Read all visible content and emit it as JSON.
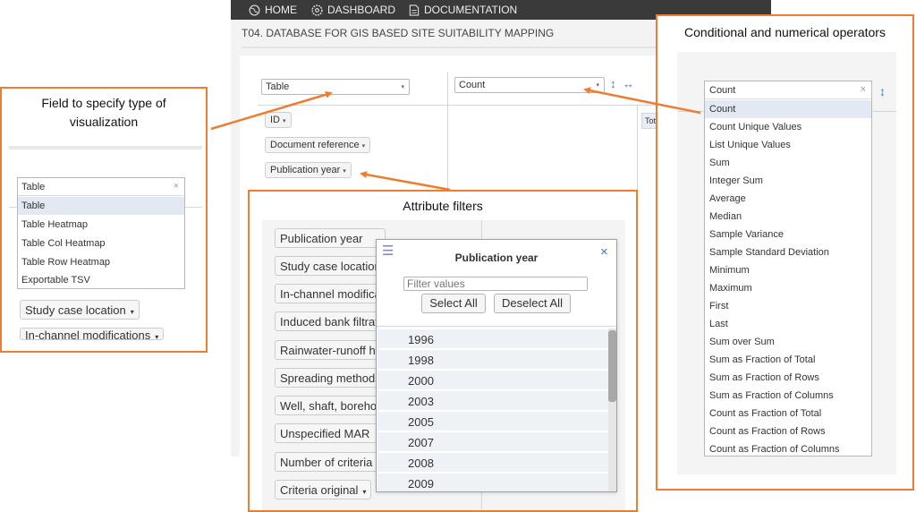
{
  "navbar": {
    "items": [
      {
        "label": "HOME",
        "icon": "globe-icon"
      },
      {
        "label": "DASHBOARD",
        "icon": "gear-icon"
      },
      {
        "label": "DOCUMENTATION",
        "icon": "document-icon"
      }
    ]
  },
  "page": {
    "title": "T04. DATABASE FOR GIS BASED SITE SUITABILITY MAPPING"
  },
  "pivot": {
    "renderer_value": "Table",
    "aggregator_value": "Count",
    "sort_icon": "↕",
    "swap_icon": "↔",
    "total_header": "Tot",
    "attributes": [
      "ID",
      "Document reference",
      "Publication year"
    ]
  },
  "callouts": {
    "viz": "Field to specify type of visualization",
    "filters": "Attribute filters",
    "operators": "Conditional and numerical operators"
  },
  "viz_dropdown": {
    "value": "Table",
    "options": [
      "Table",
      "Table Heatmap",
      "Table Col Heatmap",
      "Table Row Heatmap",
      "Exportable TSV"
    ],
    "selected_index": 0,
    "below_pills": [
      "Study case location",
      "In-channel modifications"
    ]
  },
  "attr_inset": {
    "pills": [
      "Publication year",
      "Study case location",
      "In-channel modifications",
      "Induced bank filtration",
      "Rainwater-runoff harvesting",
      "Spreading methods",
      "Well, shaft, borehole recharge",
      "Unspecified MAR",
      "Number of criteria",
      "Criteria original"
    ],
    "filter_panel": {
      "title": "Publication year",
      "search_placeholder": "Filter values",
      "select_all": "Select All",
      "deselect_all": "Deselect All",
      "values": [
        "1996",
        "1998",
        "2000",
        "2003",
        "2005",
        "2007",
        "2008",
        "2009"
      ]
    }
  },
  "operators": {
    "value": "Count",
    "options": [
      "Count",
      "Count Unique Values",
      "List Unique Values",
      "Sum",
      "Integer Sum",
      "Average",
      "Median",
      "Sample Variance",
      "Sample Standard Deviation",
      "Minimum",
      "Maximum",
      "First",
      "Last",
      "Sum over Sum",
      "Sum as Fraction of Total",
      "Sum as Fraction of Rows",
      "Sum as Fraction of Columns",
      "Count as Fraction of Total",
      "Count as Fraction of Rows",
      "Count as Fraction of Columns"
    ],
    "selected_index": 0
  },
  "colors": {
    "callout_border": "#ed7d31",
    "navbar_bg": "#3a3a3a",
    "selected_row": "#e3e9f3"
  }
}
